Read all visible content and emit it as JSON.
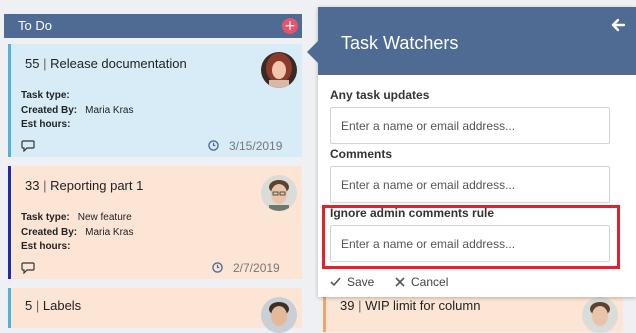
{
  "column": {
    "title": "To Do",
    "add_symbol": "+"
  },
  "cards": [
    {
      "number": "55",
      "separator": "|",
      "title": "Release documentation",
      "task_type_label": "Task type:",
      "task_type_value": "",
      "created_by_label": "Created By:",
      "created_by_value": "Maria Kras",
      "est_hours_label": "Est hours:",
      "est_hours_value": "",
      "date": "3/15/2019"
    },
    {
      "number": "33",
      "separator": "|",
      "title": "Reporting part 1",
      "task_type_label": "Task type:",
      "task_type_value": "New feature",
      "created_by_label": "Created By:",
      "created_by_value": "Maria Kras",
      "est_hours_label": "Est hours:",
      "est_hours_value": "",
      "date": "2/7/2019"
    },
    {
      "number": "5",
      "separator": "|",
      "title": "Labels"
    }
  ],
  "background_card": {
    "number": "39",
    "separator": "|",
    "title": "WIP limit for column"
  },
  "popup": {
    "title": "Task Watchers",
    "fields": [
      {
        "label": "Any task updates",
        "placeholder": "Enter a name or email address..."
      },
      {
        "label": "Comments",
        "placeholder": "Enter a name or email address..."
      },
      {
        "label": "Ignore admin comments rule",
        "placeholder": "Enter a name or email address..."
      }
    ],
    "save_label": "Save",
    "cancel_label": "Cancel"
  },
  "colors": {
    "header_blue": "#4f6b93",
    "card_blue": "#d7ecf6",
    "card_peach": "#fde5d5",
    "add_button": "#e8536b",
    "highlight": "#e3202c"
  },
  "icons": [
    "plus-icon",
    "comment-icon",
    "clock-icon",
    "back-arrow-icon",
    "check-icon",
    "x-icon"
  ]
}
